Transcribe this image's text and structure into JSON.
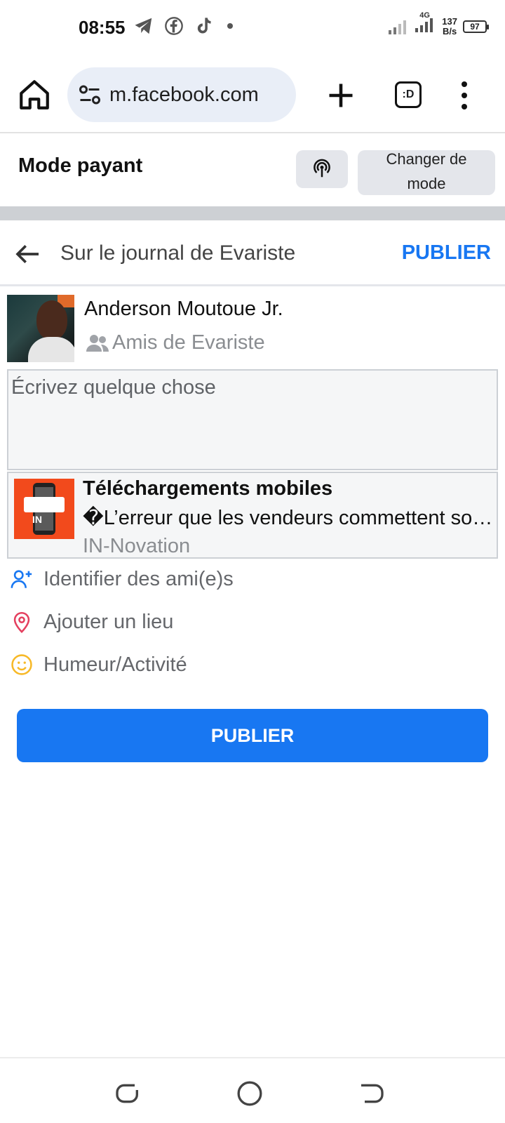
{
  "status_bar": {
    "time": "08:55",
    "net_speed_value": "137",
    "net_speed_unit": "B/s",
    "network_type": "4G",
    "battery": "97",
    "icons": [
      "telegram-icon",
      "facebook-icon",
      "tiktok-icon",
      "dot-icon"
    ]
  },
  "browser": {
    "url": "m.facebook.com",
    "tabs_label": ":D"
  },
  "mode_bar": {
    "title": "Mode payant",
    "change_line1": "Changer de",
    "change_line2": "mode"
  },
  "composer": {
    "title": "Sur le journal de Evariste",
    "publish_link": "PUBLIER",
    "author_name": "Anderson Moutoue Jr.",
    "audience": "Amis de Evariste",
    "placeholder": "Écrivez quelque chose"
  },
  "link_card": {
    "title": "Téléchargements mobiles",
    "description": "�L’erreur que les vendeurs commettent souvent",
    "source": "IN-Novation",
    "thumb_text": "IN"
  },
  "options": {
    "tag_friends": "Identifier des ami(e)s",
    "add_location": "Ajouter un lieu",
    "feeling": "Humeur/Activité"
  },
  "publish_button": "PUBLIER",
  "colors": {
    "accent": "#1877f2",
    "location_icon": "#e4405f",
    "feeling_icon": "#f7b928"
  }
}
